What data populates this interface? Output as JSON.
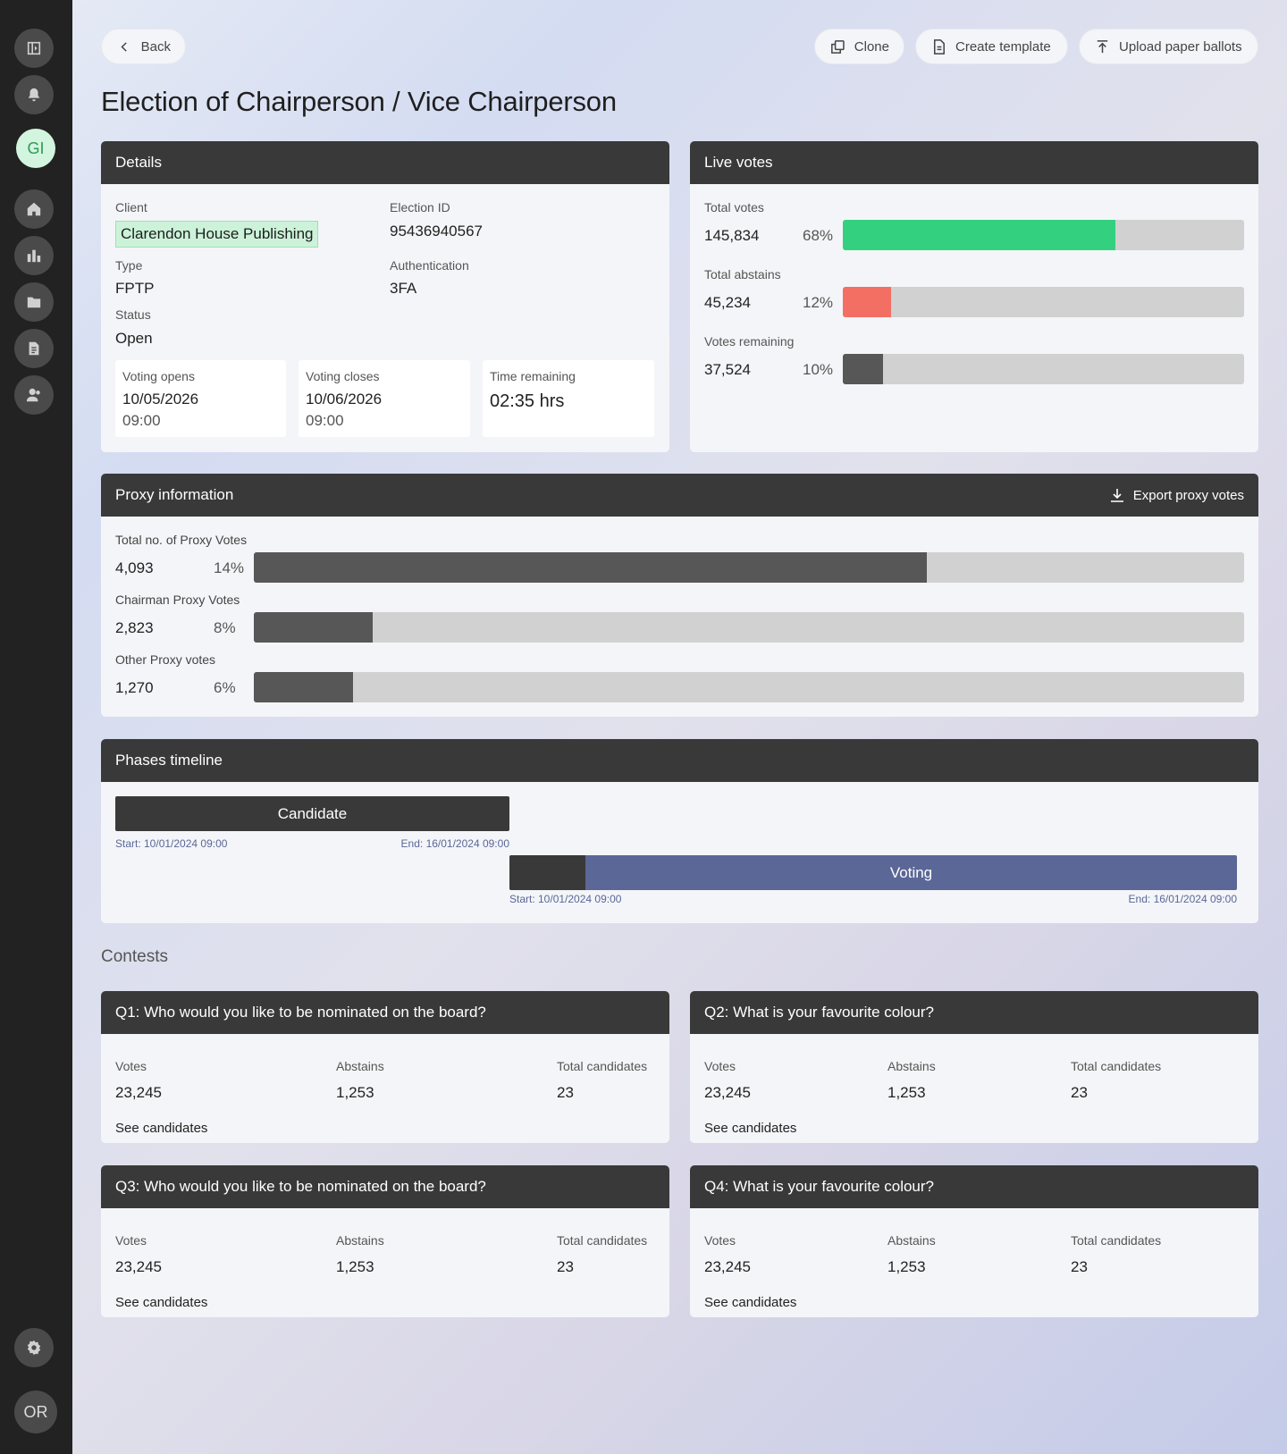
{
  "sidebar": {
    "icons": [
      "sidebar-toggle-icon",
      "bell-icon",
      "home-icon",
      "chart-icon",
      "folder-icon",
      "document-icon",
      "users-icon",
      "settings-icon"
    ],
    "avatar_initials": "GI",
    "user_initials": "OR"
  },
  "toolbar": {
    "back_label": "Back",
    "clone_label": "Clone",
    "create_template_label": "Create template",
    "upload_label": "Upload paper ballots"
  },
  "page_title": "Election of Chairperson / Vice Chairperson",
  "details": {
    "title": "Details",
    "client_label": "Client",
    "client_value": "Clarendon House Publishing",
    "election_id_label": "Election ID",
    "election_id_value": "95436940567",
    "type_label": "Type",
    "type_value": "FPTP",
    "auth_label": "Authentication",
    "auth_value": "3FA",
    "status_label": "Status",
    "status_value": "Open",
    "opens_label": "Voting opens",
    "opens_date": "10/05/2026",
    "opens_time": "09:00",
    "closes_label": "Voting closes",
    "closes_date": "10/06/2026",
    "closes_time": "09:00",
    "remaining_label": "Time remaining",
    "remaining_value": "02:35 hrs"
  },
  "live_votes": {
    "title": "Live votes",
    "rows": [
      {
        "label": "Total votes",
        "count": "145,834",
        "pct": "68%",
        "fill": 0.68,
        "color": "#33d17f"
      },
      {
        "label": "Total abstains",
        "count": "45,234",
        "pct": "12%",
        "fill": 0.12,
        "color": "#f36f63"
      },
      {
        "label": "Votes remaining",
        "count": "37,524",
        "pct": "10%",
        "fill": 0.1,
        "color": "#575757"
      }
    ]
  },
  "proxy": {
    "title": "Proxy information",
    "export_label": "Export proxy votes",
    "rows": [
      {
        "label": "Total no. of Proxy Votes",
        "count": "4,093",
        "pct": "14%",
        "fill": 0.68,
        "color": "#575757"
      },
      {
        "label": "Chairman Proxy Votes",
        "count": "2,823",
        "pct": "8%",
        "fill": 0.12,
        "color": "#575757"
      },
      {
        "label": "Other Proxy votes",
        "count": "1,270",
        "pct": "6%",
        "fill": 0.1,
        "color": "#575757"
      }
    ]
  },
  "phases": {
    "title": "Phases timeline",
    "candidate": {
      "label": "Candidate",
      "start": "Start: 10/01/2024 09:00",
      "end": "End: 16/01/2024 09:00"
    },
    "voting": {
      "label": "Voting",
      "start": "Start: 10/01/2024 09:00",
      "end": "End: 16/01/2024 09:00",
      "progress": 0.104
    }
  },
  "contests": {
    "title": "Contests",
    "items": [
      {
        "title": "Q1: Who would you like to be nominated on the board?",
        "votes_label": "Votes",
        "votes": "23,245",
        "abstains_label": "Abstains",
        "abstains": "1,253",
        "candidates_label": "Total candidates",
        "candidates": "23",
        "link": "See candidates"
      },
      {
        "title": "Q2: What is your favourite colour?",
        "votes_label": "Votes",
        "votes": "23,245",
        "abstains_label": "Abstains",
        "abstains": "1,253",
        "candidates_label": "Total candidates",
        "candidates": "23",
        "link": "See candidates"
      },
      {
        "title": "Q3: Who would you like to be nominated on the board?",
        "votes_label": "Votes",
        "votes": "23,245",
        "abstains_label": "Abstains",
        "abstains": "1,253",
        "candidates_label": "Total candidates",
        "candidates": "23",
        "link": "See candidates"
      },
      {
        "title": "Q4: What is your favourite colour?",
        "votes_label": "Votes",
        "votes": "23,245",
        "abstains_label": "Abstains",
        "abstains": "1,253",
        "candidates_label": "Total candidates",
        "candidates": "23",
        "link": "See candidates"
      }
    ]
  }
}
